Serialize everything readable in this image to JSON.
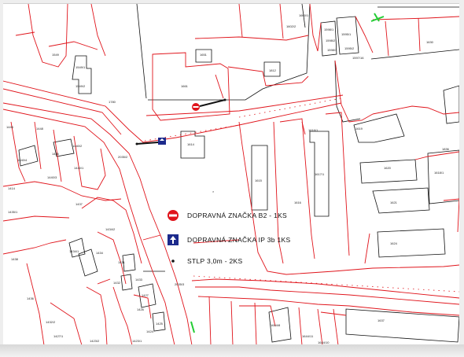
{
  "map": {
    "legend": {
      "items": [
        {
          "icon": "no-entry-sign-icon",
          "text": "DOPRAVNÁ ZNAČKA B2 - 1KS"
        },
        {
          "icon": "one-way-sign-icon",
          "text": "DOPRAVNÁ ZNAČKA IP 3b 1KS"
        },
        {
          "icon": "pole-dot-icon",
          "text": "STLP  3,0m - 2KS"
        }
      ]
    },
    "colors": {
      "parcel_line": "#e0141b",
      "building_line": "#111111",
      "sign_red": "#e0141b",
      "sign_blue": "#1c2a8c",
      "marker_green": "#22cc33"
    },
    "parcels": [
      "1549",
      "1549/1",
      "1549/2",
      "1661",
      "1651",
      "1812",
      "1614",
      "1780",
      "1414",
      "1445",
      "1448",
      "1446",
      "1440/2",
      "1440/4",
      "1440/3",
      "1440/1",
      "1438",
      "1437",
      "1434/2",
      "1434/1",
      "1434",
      "1433",
      "1432",
      "1431",
      "1428",
      "1427",
      "1426",
      "1425",
      "1424",
      "1423/1",
      "1423/2",
      "1815",
      "1616",
      "1617/1",
      "1616/1",
      "1618",
      "1619",
      "1620",
      "1621",
      "1624",
      "1836",
      "1836/1",
      "1630",
      "1637",
      "1644/8",
      "1644/11",
      "1644/10",
      "1598/1",
      "1598/2",
      "1598/3",
      "2035/2",
      "2035/3",
      "1595/1",
      "1595/2",
      "1598/4",
      "1597/16",
      "1588/1",
      "1582/1",
      "1582/2",
      "1602/2",
      "1600/1",
      "1436/1",
      "1420/3",
      "1427/1",
      "1423"
    ]
  }
}
